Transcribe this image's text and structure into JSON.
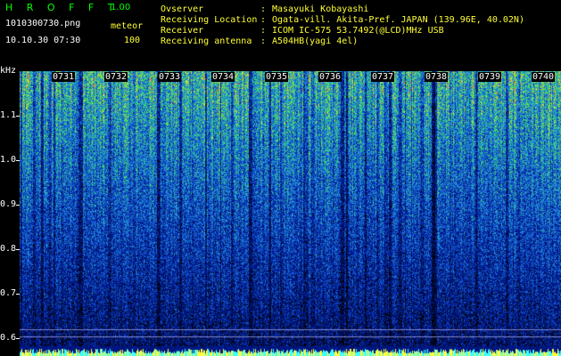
{
  "header": {
    "title": "H R O F F T",
    "version": "1.00",
    "filename": "1010300730.png",
    "mode": "meteor",
    "datetime": "10.10.30 07:30",
    "gain": "100"
  },
  "station": {
    "observer_label": "Ovserver",
    "observer_value": "Masayuki Kobayashi",
    "location_label": "Receiving Location",
    "location_value": "Ogata-vill. Akita-Pref. JAPAN (139.96E, 40.02N)",
    "receiver_label": "Receiver",
    "receiver_value": "ICOM IC-575 53.7492(@LCD)MHz USB",
    "antenna_label": "Receiving antenna",
    "antenna_value": "A504HB(yagi 4el)",
    "colon": ":"
  },
  "spectrogram": {
    "y_unit": "kHz",
    "y_ticks": [
      "1.1",
      "1.0",
      "0.9",
      "0.8",
      "0.7",
      "0.6"
    ],
    "time_labels": [
      "0731",
      "0732",
      "0733",
      "0734",
      "0735",
      "0736",
      "0737",
      "0738",
      "0739",
      "0740"
    ],
    "colors": {
      "background": "#000000",
      "low": "#0a1a6a",
      "mid": "#1e50d0",
      "high": "#30d050",
      "peak": "#ffff30",
      "accent": "#ff3030"
    }
  }
}
